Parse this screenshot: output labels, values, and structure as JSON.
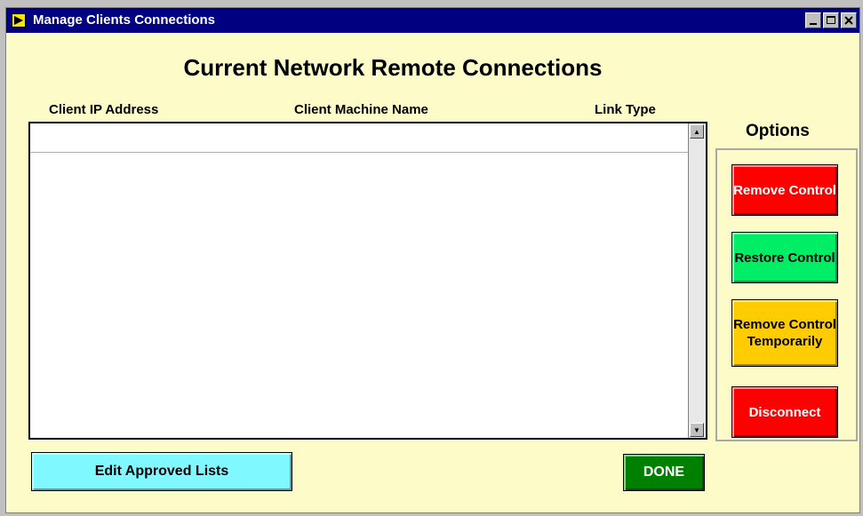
{
  "window": {
    "title": "Manage Clients Connections"
  },
  "heading": "Current Network Remote Connections",
  "columns": [
    "Client IP Address",
    "Client Machine Name",
    "Link Type"
  ],
  "options": {
    "label": "Options",
    "buttons": [
      {
        "label": "Remove Control",
        "color": "#ff0000",
        "text_color": "#ffffff"
      },
      {
        "label": "Restore Control",
        "color": "#00ee66",
        "text_color": "#000000"
      },
      {
        "label": "Remove Control Temporarily",
        "color": "#ffcc00",
        "text_color": "#000000"
      },
      {
        "label": "Disconnect",
        "color": "#ff0000",
        "text_color": "#ffffff"
      }
    ]
  },
  "footer": {
    "edit_label": "Edit Approved Lists",
    "edit_color": "#7ff8ff",
    "done_label": "DONE",
    "done_color": "#008000"
  },
  "icons": {
    "app": "labview-run-icon",
    "minimize": "minimize-icon",
    "maximize": "maximize-icon",
    "close": "close-icon",
    "scroll_up": "scroll-up-arrow-icon",
    "scroll_down": "scroll-down-arrow-icon"
  }
}
